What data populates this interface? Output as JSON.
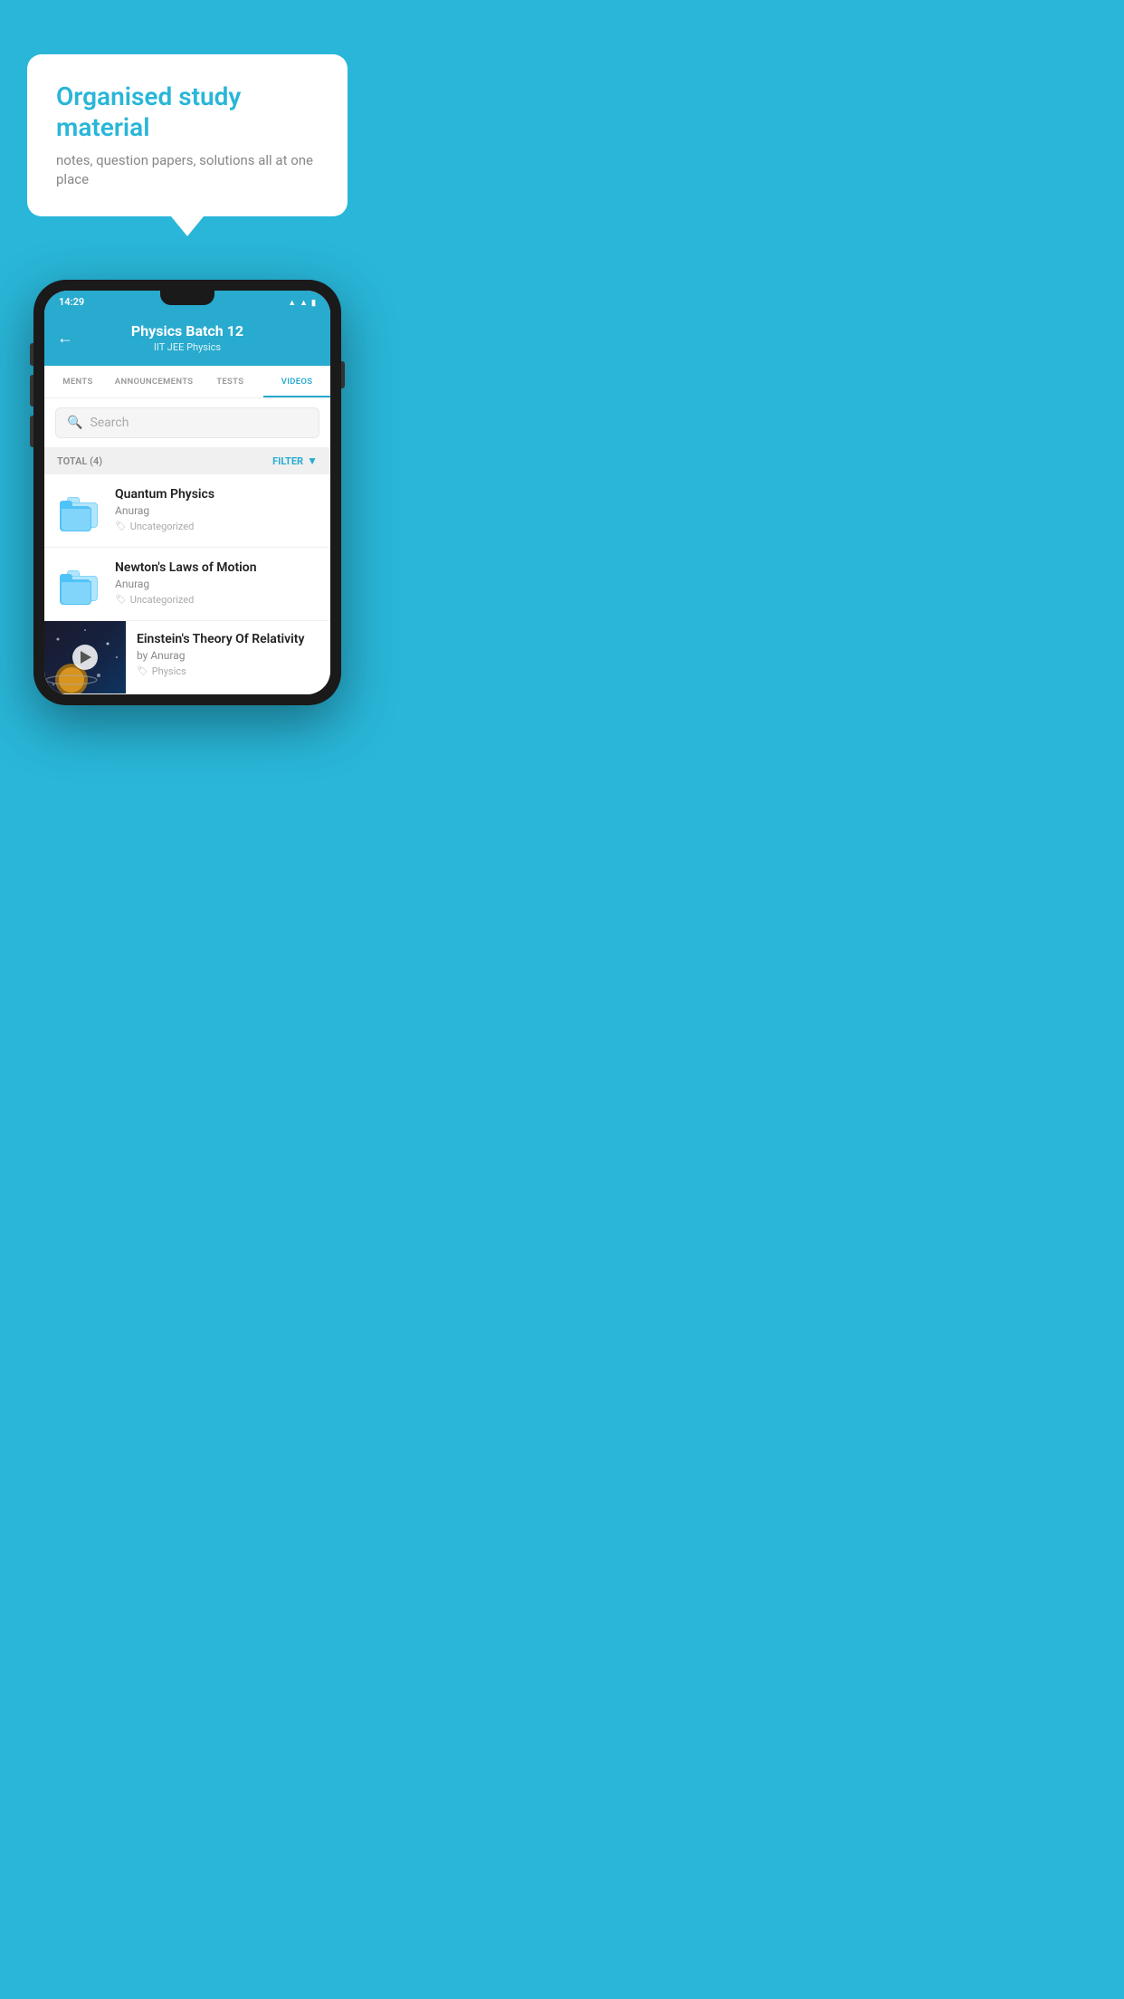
{
  "background_color": "#29B6D8",
  "speech_bubble": {
    "title": "Organised study material",
    "subtitle": "notes, question papers, solutions all at one place"
  },
  "phone": {
    "status_bar": {
      "time": "14:29",
      "icons": [
        "wifi",
        "signal",
        "battery"
      ]
    },
    "header": {
      "title": "Physics Batch 12",
      "subtitle": "IIT JEE   Physics",
      "back_label": "←"
    },
    "tabs": [
      {
        "label": "MENTS",
        "active": false
      },
      {
        "label": "ANNOUNCEMENTS",
        "active": false
      },
      {
        "label": "TESTS",
        "active": false
      },
      {
        "label": "VIDEOS",
        "active": true
      }
    ],
    "search": {
      "placeholder": "Search"
    },
    "filter_bar": {
      "total_label": "TOTAL (4)",
      "filter_label": "FILTER"
    },
    "videos": [
      {
        "title": "Quantum Physics",
        "author": "Anurag",
        "tag": "Uncategorized",
        "type": "folder"
      },
      {
        "title": "Newton's Laws of Motion",
        "author": "Anurag",
        "tag": "Uncategorized",
        "type": "folder"
      },
      {
        "title": "Einstein's Theory Of Relativity",
        "author": "by Anurag",
        "tag": "Physics",
        "type": "video"
      }
    ]
  }
}
